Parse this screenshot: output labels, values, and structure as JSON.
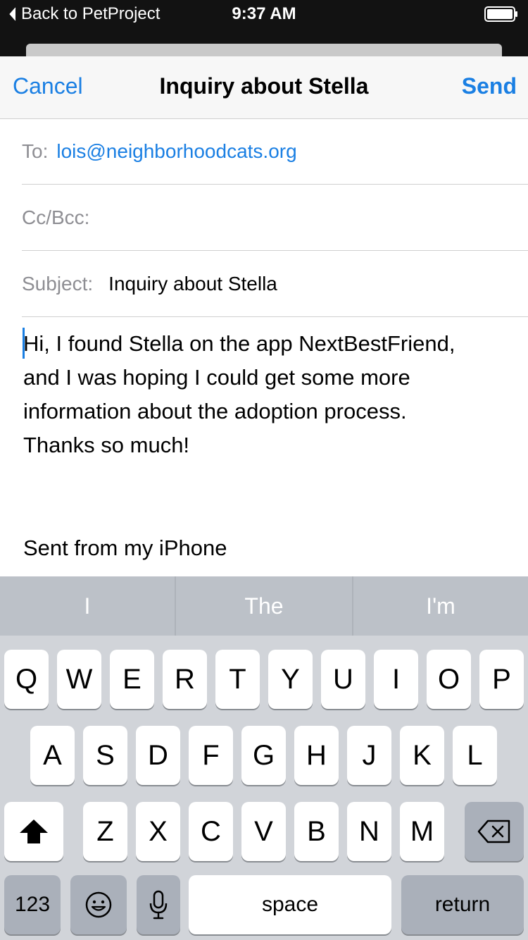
{
  "status_bar": {
    "back_label": "Back to PetProject",
    "time": "9:37 AM",
    "back_icon": "chevron-left-icon",
    "battery_icon": "battery-icon"
  },
  "navbar": {
    "cancel_label": "Cancel",
    "title": "Inquiry about Stella",
    "send_label": "Send",
    "accent_color": "#1a7fe3"
  },
  "fields": {
    "to_label": "To:",
    "to_value": "lois@neighborhoodcats.org",
    "cc_label": "Cc/Bcc:",
    "subject_label": "Subject:",
    "subject_value": "Inquiry about Stella"
  },
  "body": {
    "line1": "Hi, I found Stella on the app NextBestFriend,",
    "line2": "and I was hoping I could get some more",
    "line3": "information about the adoption process.",
    "line4": "Thanks so much!",
    "signature": "Sent from my iPhone"
  },
  "keyboard": {
    "suggestions": [
      "I",
      "The",
      "I'm"
    ],
    "row1": [
      "Q",
      "W",
      "E",
      "R",
      "T",
      "Y",
      "U",
      "I",
      "O",
      "P"
    ],
    "row2": [
      "A",
      "S",
      "D",
      "F",
      "G",
      "H",
      "J",
      "K",
      "L"
    ],
    "row3": [
      "Z",
      "X",
      "C",
      "V",
      "B",
      "N",
      "M"
    ],
    "numbers_label": "123",
    "space_label": "space",
    "return_label": "return",
    "shift_icon": "shift-icon",
    "delete_icon": "backspace-icon",
    "emoji_icon": "emoji-icon",
    "mic_icon": "microphone-icon"
  }
}
